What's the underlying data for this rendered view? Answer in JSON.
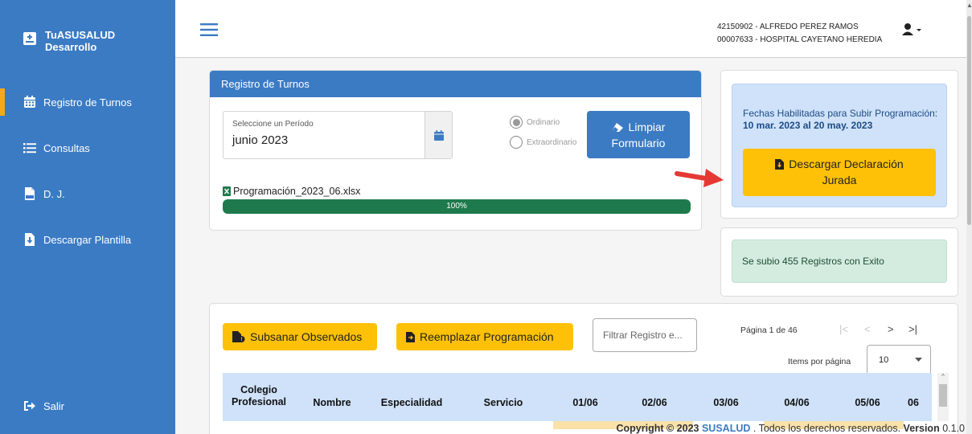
{
  "brand": {
    "line1": "TuASUSALUD",
    "line2": "Desarrollo"
  },
  "sidebar": {
    "items": [
      {
        "label": "Registro de Turnos",
        "icon": "calendar-icon",
        "active": true
      },
      {
        "label": "Consultas",
        "icon": "list-icon"
      },
      {
        "label": "D. J.",
        "icon": "pdf-file-icon"
      },
      {
        "label": "Descargar Plantilla",
        "icon": "file-download-icon"
      }
    ],
    "logout": {
      "label": "Salir",
      "icon": "sign-out-icon"
    }
  },
  "topbar": {
    "user_line1": "42150902 - ALFREDO PEREZ RAMOS",
    "user_line2": "00007633 - HOSPITAL CAYETANO HEREDIA"
  },
  "registro": {
    "title": "Registro de Turnos",
    "period_label": "Seleccione un Período",
    "period_value": "junio 2023",
    "radio_ordinario": "Ordinario",
    "radio_extraordinario": "Extraordinario",
    "radio_selected": "Ordinario",
    "limpiar_line1": "Limpiar",
    "limpiar_line2": "Formulario",
    "file_name": "Programación_2023_06.xlsx",
    "progress_label": "100%",
    "progress_value": 100
  },
  "fechas": {
    "text_prefix": "Fechas Habilitadas para Subir Programación: ",
    "text_dates": "10 mar. 2023 al 20 may. 2023",
    "btn_line1": "Descargar Declaración",
    "btn_line2": "Jurada"
  },
  "exito": {
    "message": "Se subio 455 Registros con Exito"
  },
  "tabla": {
    "btn_subsanar": "Subsanar Observados",
    "btn_reemplazar": "Reemplazar Programación",
    "filter_placeholder": "Filtrar Registro e...",
    "page_label": "Página 1 de 46",
    "items_label": "Items por página",
    "items_value": "10",
    "columns": [
      {
        "line1": "Colegio",
        "line2": "Profesional"
      },
      {
        "line1": "Nombre",
        "line2": ""
      },
      {
        "line1": "Especialidad",
        "line2": ""
      },
      {
        "line1": "Servicio",
        "line2": ""
      },
      {
        "line1": "01/06",
        "line2": ""
      },
      {
        "line1": "02/06",
        "line2": ""
      },
      {
        "line1": "03/06",
        "line2": ""
      },
      {
        "line1": "04/06",
        "line2": ""
      },
      {
        "line1": "05/06",
        "line2": ""
      },
      {
        "line1": "06",
        "line2": ""
      }
    ]
  },
  "footer": {
    "copy": "Copyright © 2023 ",
    "brand": "SUSALUD",
    "rest": " . Todos los derechos reservados. ",
    "version_label": "Version",
    "version": " 0.1.0"
  },
  "colors": {
    "sidebar": "#3b7bc4",
    "accent": "#f4a81c",
    "button_yellow": "#ffc107",
    "progress": "#1e7a4c"
  }
}
